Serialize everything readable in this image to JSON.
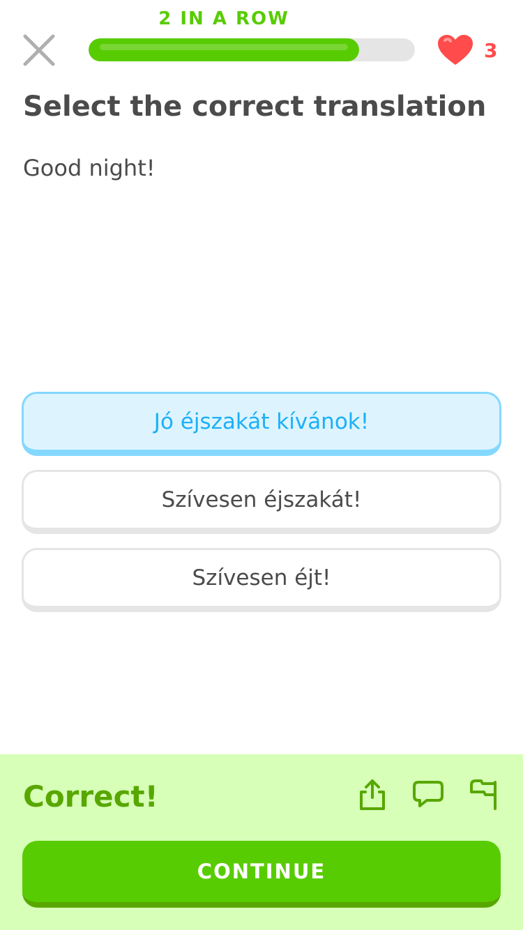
{
  "header": {
    "streak_label": "2 IN A ROW",
    "progress": 0.83,
    "hearts_count": "3"
  },
  "question": {
    "title": "Select the correct translation",
    "prompt": "Good night!"
  },
  "options": [
    {
      "label": "Jó éjszakát kívánok!",
      "selected": true
    },
    {
      "label": "Szívesen éjszakát!",
      "selected": false
    },
    {
      "label": "Szívesen éjt!",
      "selected": false
    }
  ],
  "feedback": {
    "title": "Correct!",
    "continue_label": "CONTINUE",
    "icons": [
      "share-icon",
      "comment-icon",
      "flag-icon"
    ]
  },
  "colors": {
    "brand_green": "#58cc02",
    "dark_green": "#58a700",
    "feedback_bg": "#d7ffb8",
    "selected_blue": "#1cb0f6",
    "selected_bg": "#ddf4ff",
    "heart_red": "#ff4b4b"
  }
}
